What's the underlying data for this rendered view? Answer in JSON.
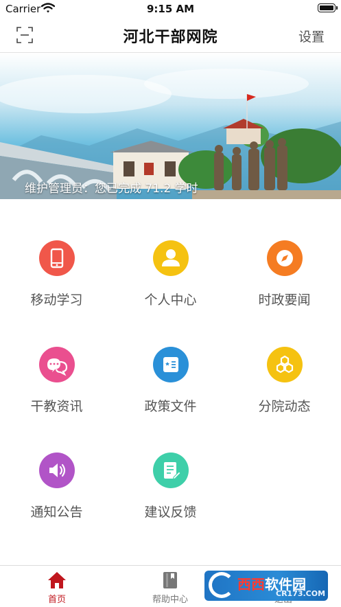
{
  "status_bar": {
    "carrier": "Carrier",
    "time": "9:15 AM"
  },
  "nav": {
    "title": "河北干部网院",
    "settings_label": "设置",
    "scan_icon": "scan-icon"
  },
  "banner": {
    "caption": "维护管理员：您已完成 71.2 学时"
  },
  "grid": [
    {
      "label": "移动学习",
      "icon": "mobile-phone-icon",
      "color": "#f0574a"
    },
    {
      "label": "个人中心",
      "icon": "user-icon",
      "color": "#f5c211"
    },
    {
      "label": "时政要闻",
      "icon": "compass-icon",
      "color": "#f57c22"
    },
    {
      "label": "干教资讯",
      "icon": "chat-bubbles-icon",
      "color": "#ea4f8f"
    },
    {
      "label": "政策文件",
      "icon": "document-icon",
      "color": "#2a90d8"
    },
    {
      "label": "分院动态",
      "icon": "hexagons-icon",
      "color": "#f5c211"
    },
    {
      "label": "通知公告",
      "icon": "speaker-icon",
      "color": "#b154c7"
    },
    {
      "label": "建议反馈",
      "icon": "feedback-edit-icon",
      "color": "#3ecfa9"
    }
  ],
  "tab_bar": {
    "home": "首页",
    "help": "帮助中心",
    "logout": "退出"
  },
  "watermark": {
    "text_red": "西西",
    "text_white": "软件园",
    "sub": "CR173.COM"
  },
  "colors": {
    "accent_red": "#c0171e"
  }
}
